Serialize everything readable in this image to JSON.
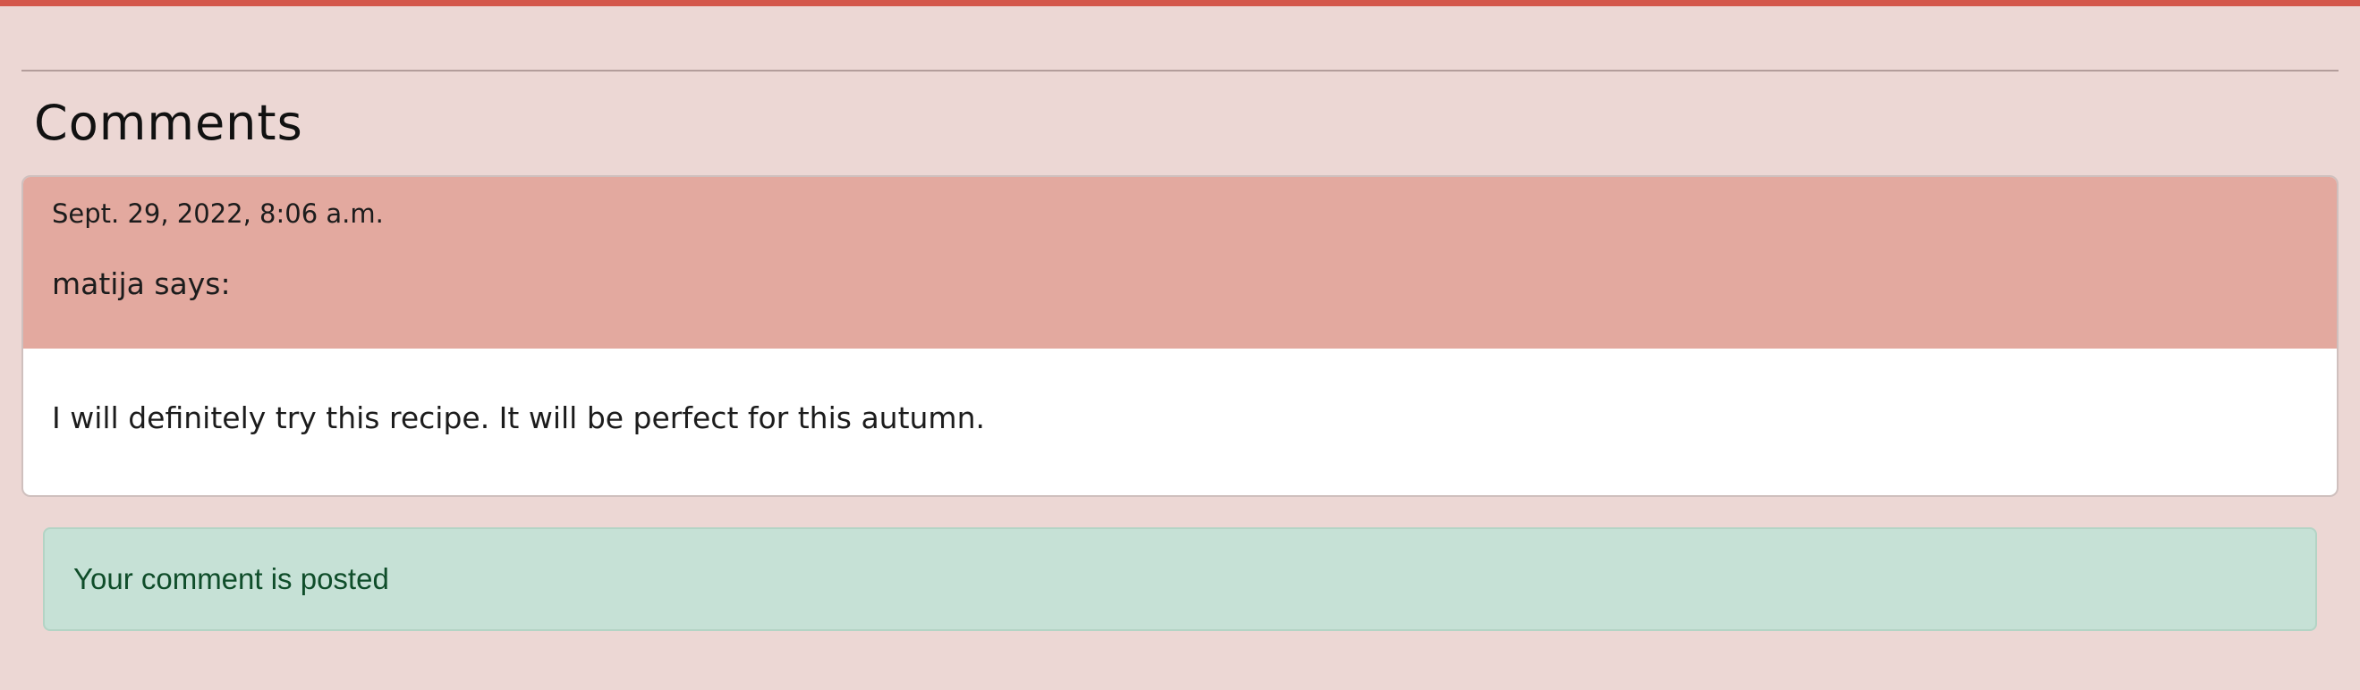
{
  "colors": {
    "page_background": "#ecd7d4",
    "top_bar": "#d4574b",
    "comment_header": "#e3a99f",
    "comment_body": "#ffffff",
    "alert_background": "#c6e1d6",
    "alert_text": "#0f4d2a"
  },
  "comments_section": {
    "title": "Comments",
    "comments": [
      {
        "date": "Sept. 29, 2022, 8:06 a.m.",
        "author_line": "matija says:",
        "body": "I will definitely try this recipe. It will be perfect for this autumn."
      }
    ]
  },
  "alert": {
    "message": "Your comment is posted"
  }
}
